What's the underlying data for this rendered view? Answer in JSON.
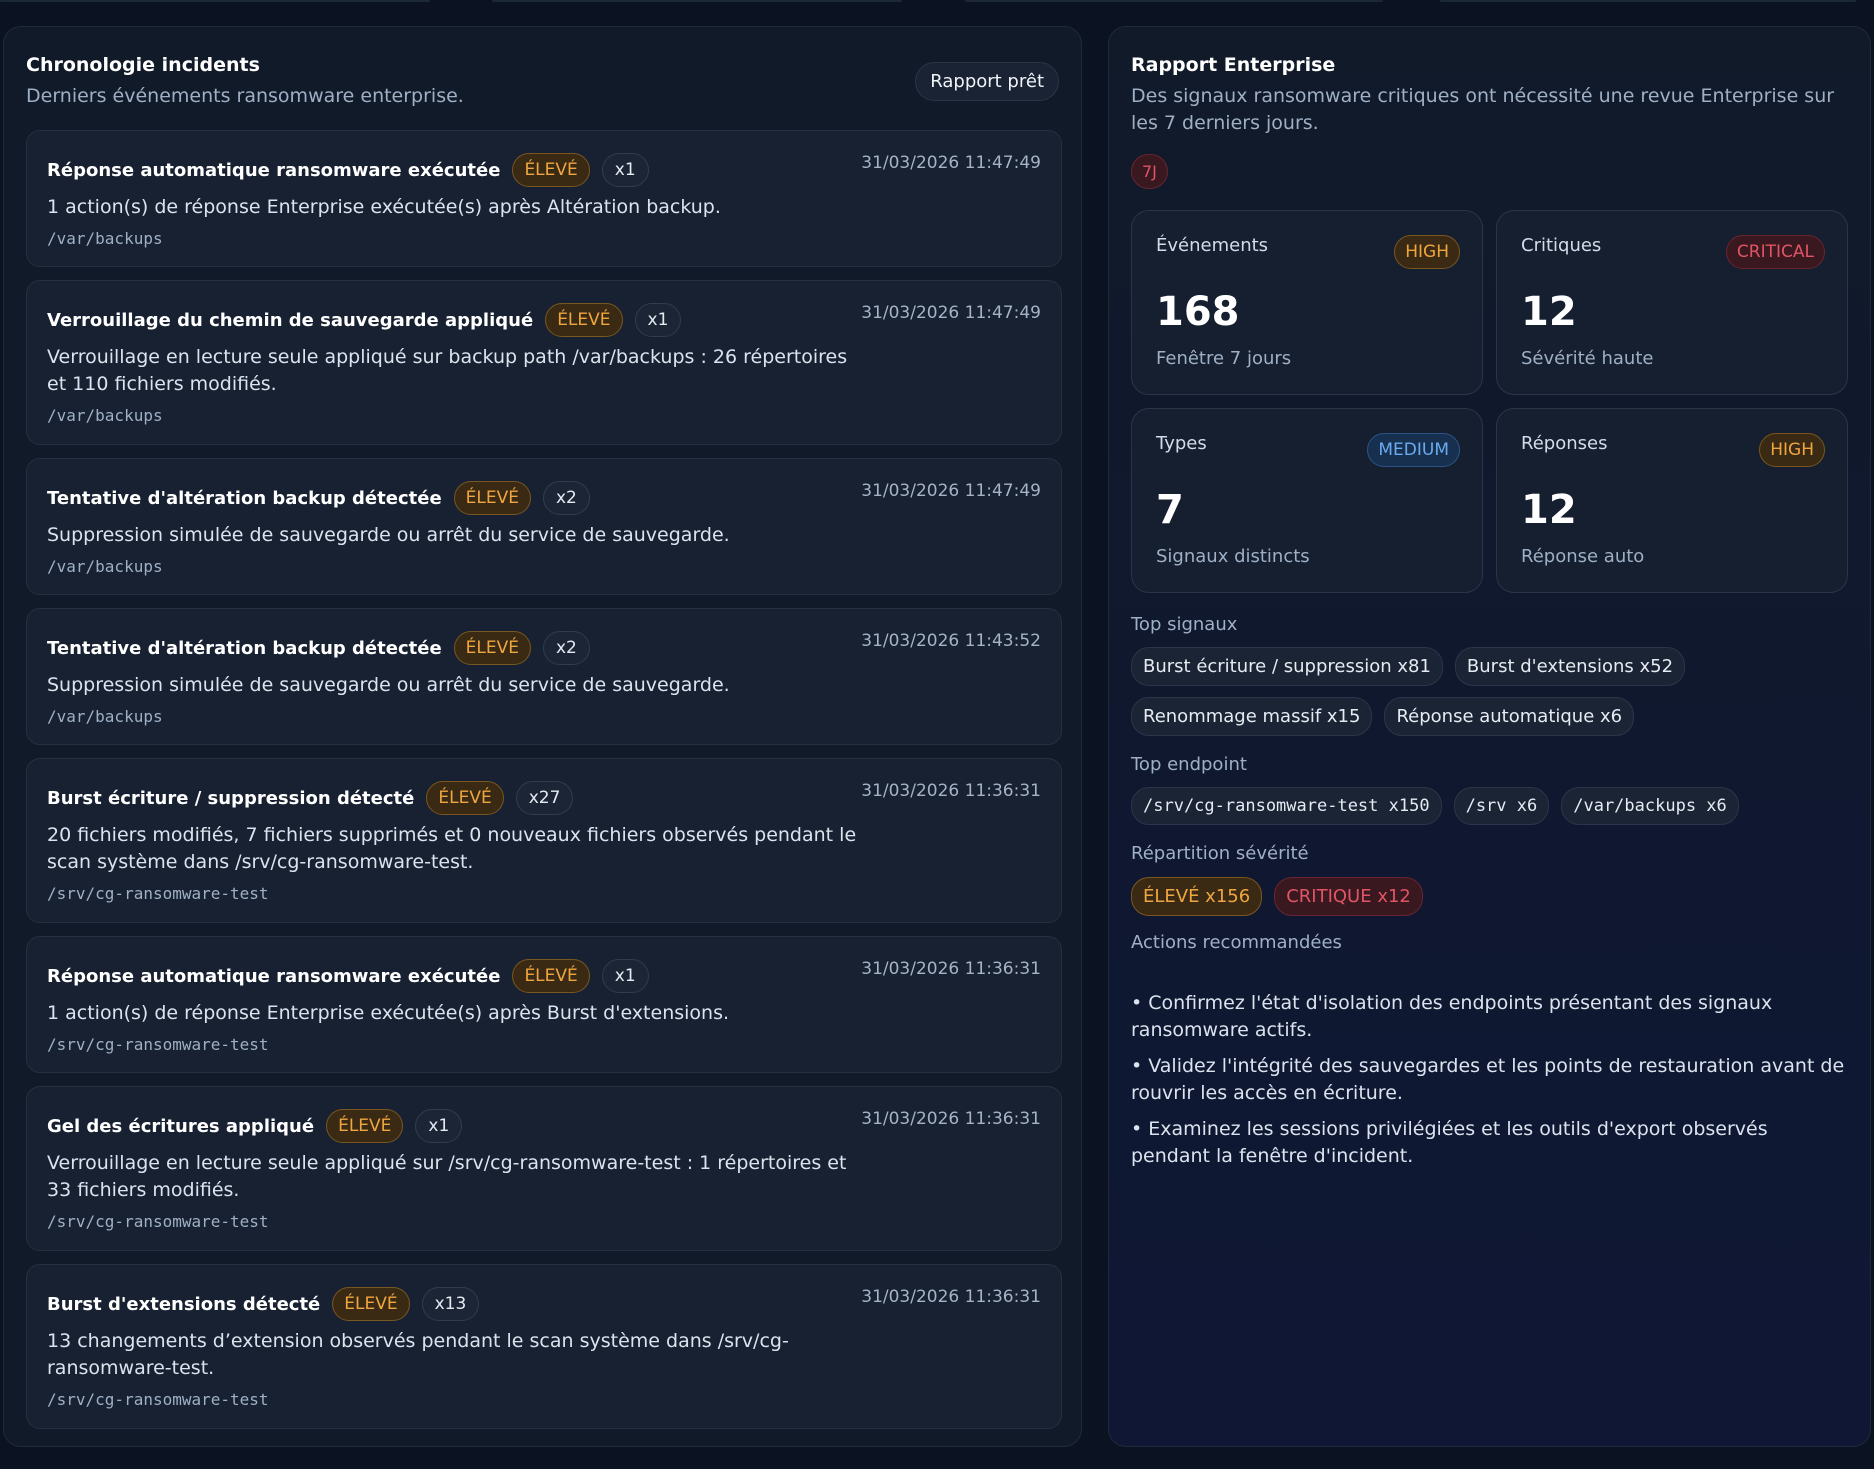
{
  "timeline": {
    "title": "Chronologie incidents",
    "subtitle": "Derniers événements ransomware enterprise.",
    "status_pill": "Rapport prêt",
    "events": [
      {
        "title": "Réponse automatique ransomware exécutée",
        "severity": "ÉLEVÉ",
        "count": "x1",
        "time": "31/03/2026 11:47:49",
        "description": "1 action(s) de réponse Enterprise exécutée(s) après Altération backup.",
        "path": "/var/backups"
      },
      {
        "title": "Verrouillage du chemin de sauvegarde appliqué",
        "severity": "ÉLEVÉ",
        "count": "x1",
        "time": "31/03/2026 11:47:49",
        "description": "Verrouillage en lecture seule appliqué sur backup path /var/backups : 26 répertoires et 110 fichiers modifiés.",
        "path": "/var/backups"
      },
      {
        "title": "Tentative d'altération backup détectée",
        "severity": "ÉLEVÉ",
        "count": "x2",
        "time": "31/03/2026 11:47:49",
        "description": "Suppression simulée de sauvegarde ou arrêt du service de sauvegarde.",
        "path": "/var/backups"
      },
      {
        "title": "Tentative d'altération backup détectée",
        "severity": "ÉLEVÉ",
        "count": "x2",
        "time": "31/03/2026 11:43:52",
        "description": "Suppression simulée de sauvegarde ou arrêt du service de sauvegarde.",
        "path": "/var/backups"
      },
      {
        "title": "Burst écriture / suppression détecté",
        "severity": "ÉLEVÉ",
        "count": "x27",
        "time": "31/03/2026 11:36:31",
        "description": "20 fichiers modifiés, 7 fichiers supprimés et 0 nouveaux fichiers observés pendant le scan système dans /srv/cg-ransomware-test.",
        "path": "/srv/cg-ransomware-test"
      },
      {
        "title": "Réponse automatique ransomware exécutée",
        "severity": "ÉLEVÉ",
        "count": "x1",
        "time": "31/03/2026 11:36:31",
        "description": "1 action(s) de réponse Enterprise exécutée(s) après Burst d'extensions.",
        "path": "/srv/cg-ransomware-test"
      },
      {
        "title": "Gel des écritures appliqué",
        "severity": "ÉLEVÉ",
        "count": "x1",
        "time": "31/03/2026 11:36:31",
        "description": "Verrouillage en lecture seule appliqué sur /srv/cg-ransomware-test : 1 répertoires et 33 fichiers modifiés.",
        "path": "/srv/cg-ransomware-test"
      },
      {
        "title": "Burst d'extensions détecté",
        "severity": "ÉLEVÉ",
        "count": "x13",
        "time": "31/03/2026 11:36:31",
        "description": "13 changements d’extension observés pendant le scan système dans /srv/cg-ransomware-test.",
        "path": "/srv/cg-ransomware-test"
      }
    ]
  },
  "report": {
    "title": "Rapport Enterprise",
    "subtitle": "Des signaux ransomware critiques ont nécessité une revue Enterprise sur les 7 derniers jours.",
    "window_badge": "7J",
    "stats": [
      {
        "label": "Événements",
        "value": "168",
        "sub": "Fenêtre 7 jours",
        "badge": "HIGH"
      },
      {
        "label": "Critiques",
        "value": "12",
        "sub": "Sévérité haute",
        "badge": "CRITICAL"
      },
      {
        "label": "Types",
        "value": "7",
        "sub": "Signaux distincts",
        "badge": "MEDIUM"
      },
      {
        "label": "Réponses",
        "value": "12",
        "sub": "Réponse auto",
        "badge": "HIGH"
      }
    ],
    "top_signals_label": "Top signaux",
    "top_signals": [
      "Burst écriture / suppression x81",
      "Burst d'extensions x52",
      "Renommage massif x15",
      "Réponse automatique x6"
    ],
    "top_endpoint_label": "Top endpoint",
    "top_endpoints": [
      "/srv/cg-ransomware-test x150",
      "/srv x6",
      "/var/backups x6"
    ],
    "severity_label": "Répartition sévérité",
    "severity_split": [
      "ÉLEVÉ x156",
      "CRITIQUE x12"
    ],
    "actions_label": "Actions recommandées",
    "actions": [
      "• Confirmez l'état d'isolation des endpoints présentant des signaux ransomware actifs.",
      "• Validez l'intégrité des sauvegardes et les points de restauration avant de rouvrir les accès en écriture.",
      "• Examinez les sessions privilégiées et les outils d'export observés pendant la fenêtre d'incident."
    ]
  }
}
